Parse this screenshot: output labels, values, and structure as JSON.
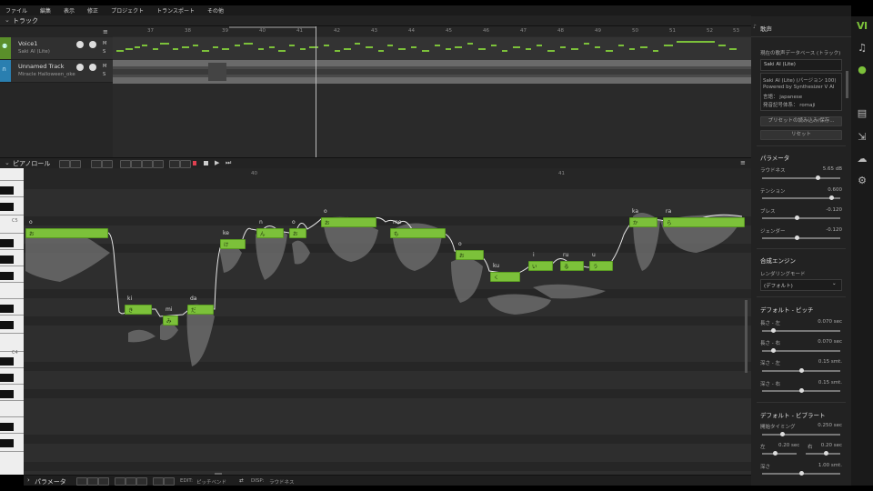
{
  "menu": [
    "ファイル",
    "編集",
    "表示",
    "修正",
    "プロジェクト",
    "トランスポート",
    "その他"
  ],
  "tracks_panel": {
    "title": "トラック"
  },
  "tracks": [
    {
      "name": "Voice1",
      "sub": "Saki AI (Lite)",
      "color": "#7cc13a"
    },
    {
      "name": "Unnamed Track",
      "sub": "Miracle Halloween_oke",
      "color": "#3aa3e0"
    }
  ],
  "timeline_ticks": [
    "37",
    "38",
    "39",
    "40",
    "41",
    "42",
    "43",
    "44",
    "45",
    "46",
    "47",
    "48",
    "49",
    "50",
    "51",
    "52",
    "53"
  ],
  "piano_roll": {
    "title": "ピアノロール",
    "ruler": [
      "40",
      "41"
    ],
    "key_labels": [
      "C5",
      "C4"
    ]
  },
  "notes": [
    {
      "lyric": "o",
      "text": "お"
    },
    {
      "lyric": "ki",
      "text": "き"
    },
    {
      "lyric": "mi",
      "text": "み"
    },
    {
      "lyric": "da",
      "text": "だ"
    },
    {
      "lyric": "ke",
      "text": "け"
    },
    {
      "lyric": "n",
      "text": "ん"
    },
    {
      "lyric": "o",
      "text": "お"
    },
    {
      "lyric": "o",
      "text": "お"
    },
    {
      "lyric": "mo",
      "text": "も"
    },
    {
      "lyric": "o",
      "text": "お"
    },
    {
      "lyric": "ku",
      "text": "く"
    },
    {
      "lyric": "i",
      "text": "い"
    },
    {
      "lyric": "ru",
      "text": "る"
    },
    {
      "lyric": "u",
      "text": "う"
    },
    {
      "lyric": "ka",
      "text": "か"
    },
    {
      "lyric": "ra",
      "text": "ら"
    }
  ],
  "param_bar": {
    "title": "パラメータ",
    "edit_label": "EDIT:",
    "edit_value": "ピッチベンド",
    "disp_label": "DISP:",
    "disp_value": "ラウドネス"
  },
  "right_panel": {
    "header": "歌声",
    "db_label": "現在の歌声データベース (トラック)",
    "db_value": "Saki AI (Lite)",
    "info": [
      "Saki AI (Lite) (バージョン 100)",
      "Powered by Synthesizer V AI",
      "言語：  japanese",
      "発音記号体系：  romaji"
    ],
    "preset_btn": "プリセットの読み込み/保存...",
    "reset_btn": "リセット",
    "params_title": "パラメータ",
    "params": [
      {
        "label": "ラウドネス",
        "value": "5.65 dB",
        "level": 0.62
      },
      {
        "label": "テンション",
        "value": "0.600",
        "level": 0.8
      },
      {
        "label": "ブレス",
        "value": "-0.120",
        "level": 0.44
      },
      {
        "label": "ジェンダー",
        "value": "-0.120",
        "level": 0.44
      }
    ],
    "engine_title": "合成エンジン",
    "render_mode_label": "レンダリングモード",
    "render_mode_value": "(デフォルト)",
    "pitch_title": "デフォルト - ピッチ",
    "pitch": [
      {
        "label": "長さ - 左",
        "value": "0.070 sec",
        "level": 0.1
      },
      {
        "label": "長さ - 右",
        "value": "0.070 sec",
        "level": 0.1
      },
      {
        "label": "深さ - 左",
        "value": "0.15 smt.",
        "level": 0.5
      },
      {
        "label": "深さ - 右",
        "value": "0.15 smt.",
        "level": 0.5
      }
    ],
    "vibrato_title": "デフォルト - ビブラート",
    "vib_timing_label": "開始タイミング",
    "vib_timing_value": "0.250 sec",
    "vib_left_label": "左",
    "vib_left_value": "0.20 sec",
    "vib_right_label": "右",
    "vib_right_value": "0.20 sec",
    "vib_depth_label": "深さ",
    "vib_depth_value": "1.00 smt."
  },
  "sidebar_icons": [
    "logo-icon",
    "music-note-icon",
    "microphone-icon",
    "book-icon",
    "export-icon",
    "cloud-icon",
    "gear-icon"
  ]
}
